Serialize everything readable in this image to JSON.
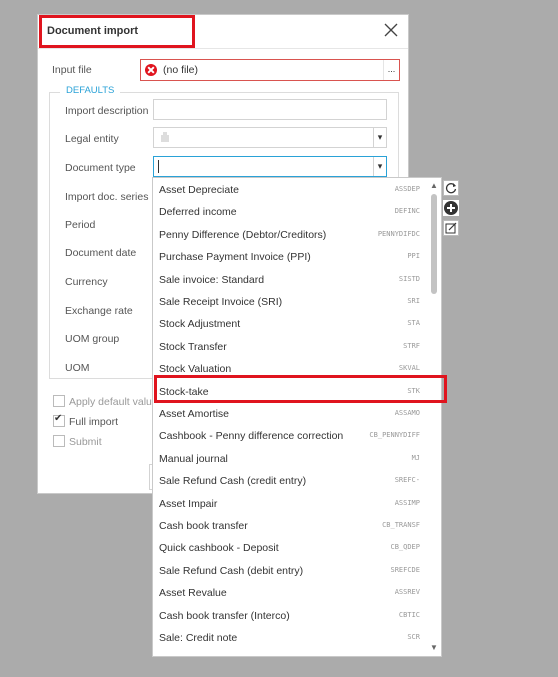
{
  "dialog": {
    "title": "Document import",
    "input_file_label": "Input file",
    "input_file_value": "(no file)",
    "input_file_button": "...",
    "defaults_legend": "DEFAULTS",
    "fields": {
      "import_description": "Import description",
      "legal_entity": "Legal entity",
      "document_type": "Document type",
      "import_doc_series": "Import doc. series",
      "period": "Period",
      "document_date": "Document date",
      "currency": "Currency",
      "exchange_rate": "Exchange rate",
      "uom_group": "UOM group",
      "uom": "UOM"
    },
    "checkboxes": {
      "apply_default": "Apply default valu",
      "full_import": "Full import",
      "submit": "Submit"
    }
  },
  "dropdown": {
    "options": [
      {
        "name": "Asset Depreciate",
        "code": "ASSDEP"
      },
      {
        "name": "Deferred income",
        "code": "DEFINC"
      },
      {
        "name": "Penny Difference (Debtor/Creditors)",
        "code": "PENNYDIFDC"
      },
      {
        "name": "Purchase Payment Invoice (PPI)",
        "code": "PPI"
      },
      {
        "name": "Sale invoice: Standard",
        "code": "SISTD"
      },
      {
        "name": "Sale Receipt Invoice (SRI)",
        "code": "SRI"
      },
      {
        "name": "Stock Adjustment",
        "code": "STA"
      },
      {
        "name": "Stock Transfer",
        "code": "STRF"
      },
      {
        "name": "Stock Valuation",
        "code": "SKVAL"
      },
      {
        "name": "Stock-take",
        "code": "STK"
      },
      {
        "name": "Asset Amortise",
        "code": "ASSAMO"
      },
      {
        "name": "Cashbook - Penny difference correction",
        "code": "CB_PENNYDIFF"
      },
      {
        "name": "Manual journal",
        "code": "MJ"
      },
      {
        "name": "Sale Refund Cash (credit entry)",
        "code": "SREFC-"
      },
      {
        "name": "Asset Impair",
        "code": "ASSIMP"
      },
      {
        "name": "Cash book transfer",
        "code": "CB_TRANSF"
      },
      {
        "name": "Quick cashbook - Deposit",
        "code": "CB_QDEP"
      },
      {
        "name": "Sale Refund Cash (debit entry)",
        "code": "SREFCDE"
      },
      {
        "name": "Asset Revalue",
        "code": "ASSREV"
      },
      {
        "name": "Cash book transfer (Interco)",
        "code": "CBTIC"
      },
      {
        "name": "Sale: Credit note",
        "code": "SCR"
      }
    ]
  },
  "colors": {
    "accent": "#2aa2d7",
    "highlight_red": "#e0141e",
    "error": "#e0141e"
  }
}
